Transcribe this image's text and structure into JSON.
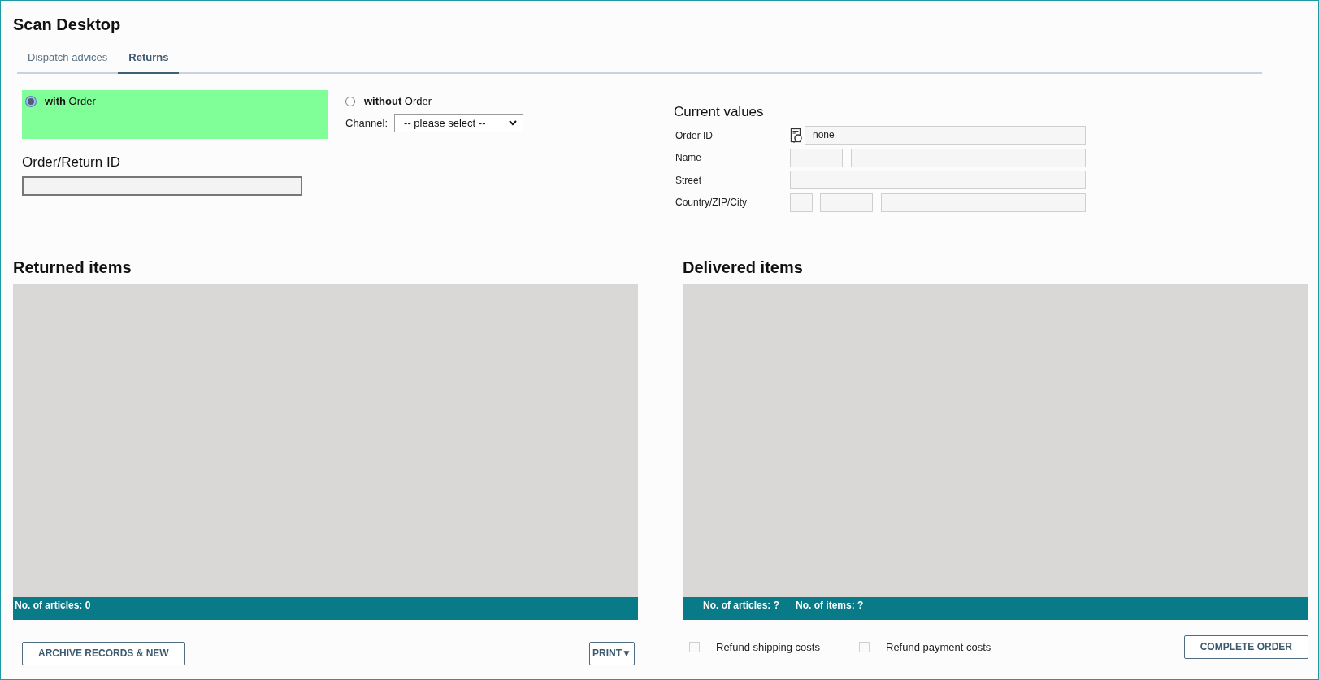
{
  "window": {
    "title": "Scan Desktop"
  },
  "tabs": [
    {
      "label": "Dispatch advices",
      "selected": false
    },
    {
      "label": "Returns",
      "selected": true
    }
  ],
  "order_mode": {
    "options": [
      {
        "label": "**with** Order",
        "selected": true
      },
      {
        "label": "**without** Order",
        "selected": false,
        "channel": {
          "label": "Channel:",
          "value": "-- please select --"
        }
      }
    ]
  },
  "order_return_id": {
    "label": "Order/Return ID",
    "focused": true
  },
  "current_values": {
    "title": "Current values",
    "rows": [
      {
        "kind": "lookup",
        "label": "Order ID",
        "value": "none"
      },
      {
        "kind": "name",
        "label": "Name"
      },
      {
        "kind": "single",
        "label": "Street"
      },
      {
        "kind": "address",
        "label": "Country/ZIP/City"
      }
    ]
  },
  "returned_items": {
    "title": "Returned items",
    "footer": [
      "No. of articles: 0"
    ],
    "actions": [
      {
        "kind": "button",
        "label": "ARCHIVE RECORDS & NEW"
      },
      {
        "kind": "menu_button",
        "label": "PRINT▼"
      }
    ]
  },
  "delivered_items": {
    "title": "Delivered items",
    "footer": [
      "No. of articles: ?",
      "No. of items: ?"
    ],
    "actions": [
      {
        "kind": "checkbox",
        "label": "Refund shipping costs",
        "checked": false
      },
      {
        "kind": "checkbox",
        "label": "Refund payment costs",
        "checked": false
      },
      {
        "kind": "button",
        "label": "COMPLETE ORDER"
      }
    ]
  }
}
